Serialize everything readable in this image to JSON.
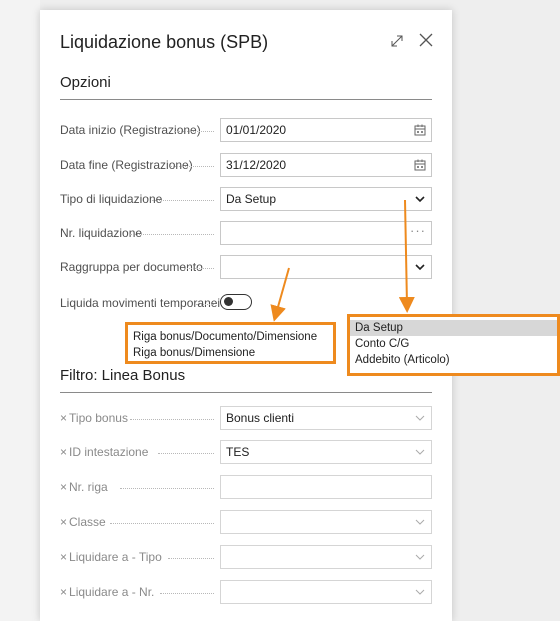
{
  "dialog": {
    "title": "Liquidazione bonus (SPB)"
  },
  "options_section": {
    "title": "Opzioni",
    "fields": {
      "start_date": {
        "label": "Data inizio (Registrazione)",
        "value": "01/01/2020",
        "icon": "calendar-icon"
      },
      "end_date": {
        "label": "Data fine (Registrazione)",
        "value": "31/12/2020",
        "icon": "calendar-icon"
      },
      "settlement_type": {
        "label": "Tipo di liquidazione",
        "value": "Da Setup"
      },
      "settlement_no": {
        "label": "Nr. liquidazione",
        "value": "",
        "assist": "···"
      },
      "group_by_document": {
        "label": "Raggruppa per documento",
        "value": ""
      },
      "settle_temp_entries": {
        "label": "Liquida movimenti temporanei",
        "value": false
      }
    }
  },
  "group_dropdown": {
    "options": [
      "Riga bonus/Documento/Dimensione",
      "Riga bonus/Dimensione"
    ]
  },
  "type_dropdown": {
    "options": [
      "Da Setup",
      "Conto C/G",
      "Addebito (Articolo)"
    ],
    "selected": "Da Setup"
  },
  "filter_section": {
    "title": "Filtro: Linea Bonus",
    "remove_symbol": "×",
    "fields": [
      {
        "label": "Tipo bonus",
        "value": "Bonus clienti"
      },
      {
        "label": "ID intestazione",
        "value": "TES"
      },
      {
        "label": "Nr. riga",
        "value": ""
      },
      {
        "label": "Classe",
        "value": ""
      },
      {
        "label": "Liquidare a - Tipo",
        "value": ""
      },
      {
        "label": "Liquidare a - Nr.",
        "value": ""
      }
    ]
  },
  "colors": {
    "highlight": "#ee8a1e",
    "selected_option": "#d7d7d7"
  }
}
